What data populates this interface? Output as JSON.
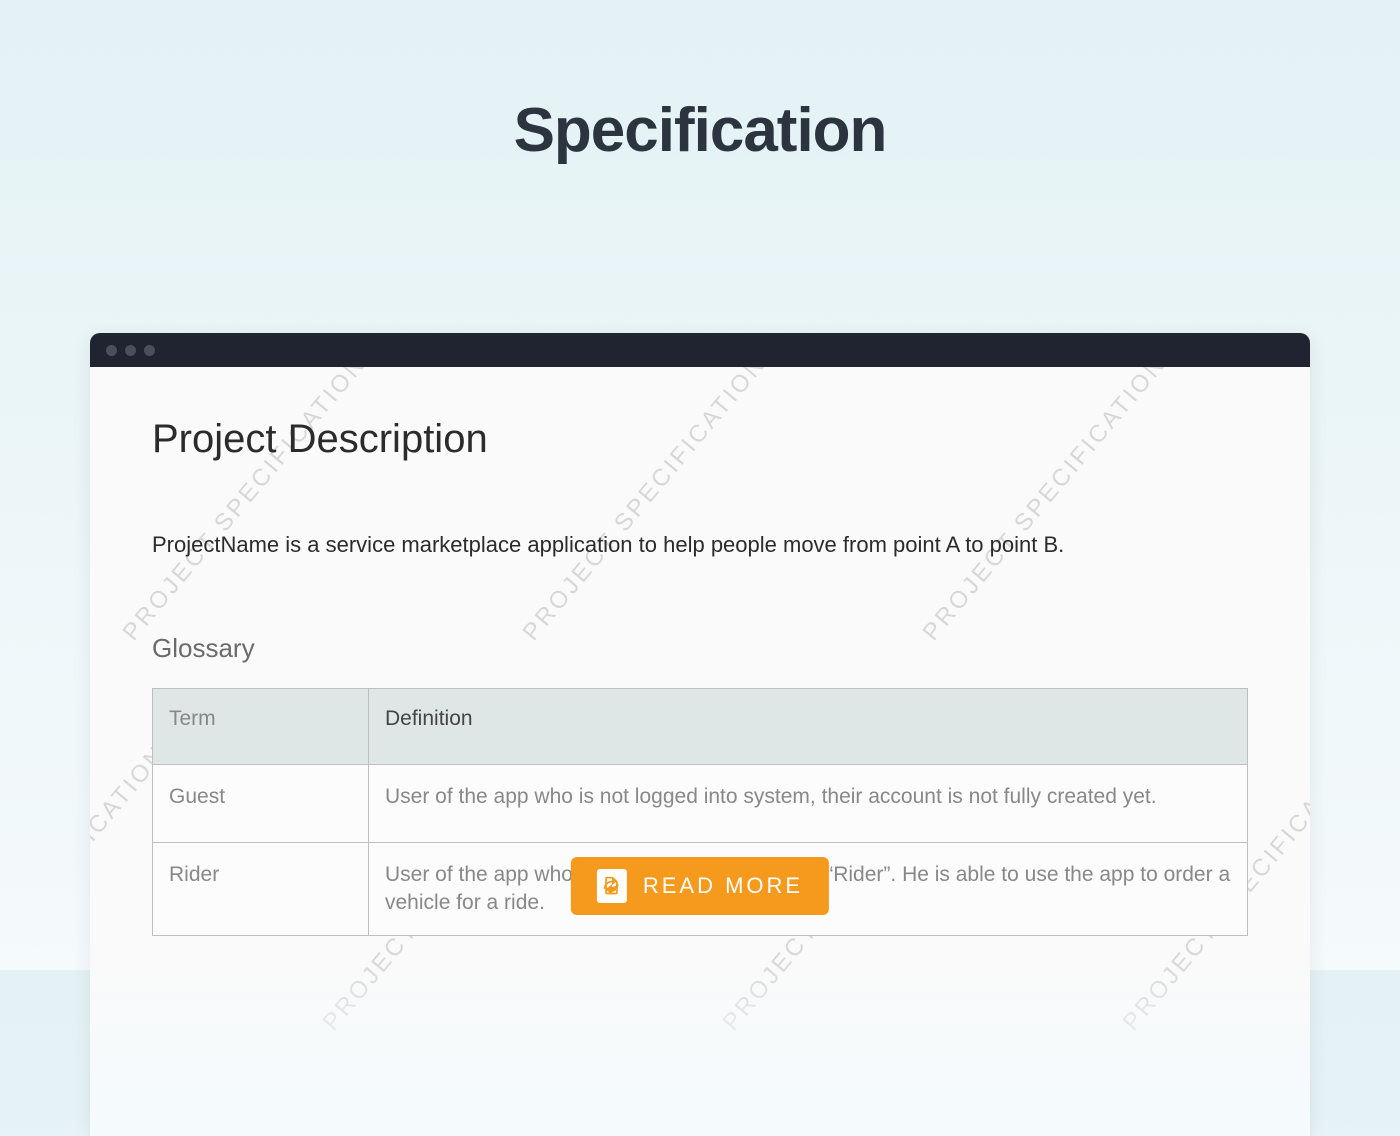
{
  "page": {
    "title": "Specification"
  },
  "watermark_text": "PROJECT SPECIFICATIONS",
  "document": {
    "heading": "Project Description",
    "paragraph": "ProjectName is a service marketplace application to help people move from point A to point B.",
    "glossary": {
      "heading": "Glossary",
      "columns": [
        "Term",
        "Definition"
      ],
      "rows": [
        {
          "term": "Guest",
          "definition": "User of the app who is not logged into system, their account is not fully created yet."
        },
        {
          "term": "Rider",
          "definition": "User of the app who is logged into system as a “Rider”. He is able to use the app to order a vehicle for a ride."
        }
      ]
    }
  },
  "button": {
    "read_more": "READ MORE"
  }
}
